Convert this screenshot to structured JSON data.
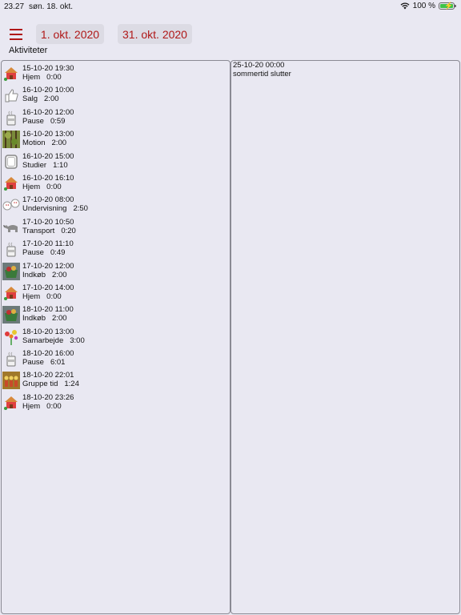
{
  "status": {
    "time": "23.27",
    "date": "søn. 18. okt.",
    "battery": "100 %",
    "battery_level": 1.0,
    "wifi_icon": "wifi-icon"
  },
  "header": {
    "menu_icon": "hamburger-menu-icon",
    "from_date": "1. okt. 2020",
    "to_date": "31. okt. 2020",
    "accent": "#b01818"
  },
  "section_title": "Aktiviteter",
  "activities": [
    {
      "datetime": "15-10-20 19:30",
      "name": "Hjem",
      "duration": "0:00",
      "icon": "house-icon"
    },
    {
      "datetime": "16-10-20 10:00",
      "name": "Salg",
      "duration": "2:00",
      "icon": "thumbs-up-icon"
    },
    {
      "datetime": "16-10-20 12:00",
      "name": "Pause",
      "duration": "0:59",
      "icon": "coffee-cup-icon"
    },
    {
      "datetime": "16-10-20 13:00",
      "name": "Motion",
      "duration": "2:00",
      "icon": "forest-icon"
    },
    {
      "datetime": "16-10-20 15:00",
      "name": "Studier",
      "duration": "1:10",
      "icon": "frame-icon"
    },
    {
      "datetime": "16-10-20 16:10",
      "name": "Hjem",
      "duration": "0:00",
      "icon": "house-icon"
    },
    {
      "datetime": "17-10-20 08:00",
      "name": "Undervisning",
      "duration": "2:50",
      "icon": "faces-icon"
    },
    {
      "datetime": "17-10-20 10:50",
      "name": "Transport",
      "duration": "0:20",
      "icon": "rhino-icon"
    },
    {
      "datetime": "17-10-20 11:10",
      "name": "Pause",
      "duration": "0:49",
      "icon": "coffee-cup-icon"
    },
    {
      "datetime": "17-10-20 12:00",
      "name": "Indkøb",
      "duration": "2:00",
      "icon": "shopping-basket-icon"
    },
    {
      "datetime": "17-10-20 14:00",
      "name": "Hjem",
      "duration": "0:00",
      "icon": "house-icon"
    },
    {
      "datetime": "18-10-20 11:00",
      "name": "Indkøb",
      "duration": "2:00",
      "icon": "shopping-basket-icon"
    },
    {
      "datetime": "18-10-20 13:00",
      "name": "Samarbejde",
      "duration": "3:00",
      "icon": "flowers-icon"
    },
    {
      "datetime": "18-10-20 16:00",
      "name": "Pause",
      "duration": "6:01",
      "icon": "coffee-cup-icon"
    },
    {
      "datetime": "18-10-20 22:01",
      "name": "Gruppe tid",
      "duration": "1:24",
      "icon": "group-icon"
    },
    {
      "datetime": "18-10-20 23:26",
      "name": "Hjem",
      "duration": "0:00",
      "icon": "house-icon"
    }
  ],
  "event": {
    "datetime": "25-10-20 00:00",
    "text": "sommertid slutter"
  }
}
